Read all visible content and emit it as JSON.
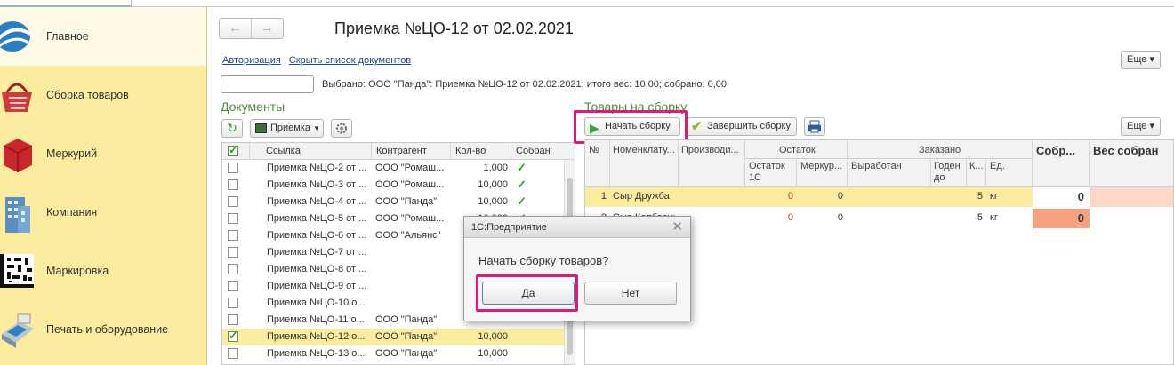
{
  "sidebar": {
    "items": [
      {
        "label": "Главное",
        "icon": "globe-logo-icon",
        "active": true
      },
      {
        "label": "Сборка товаров",
        "icon": "shopping-basket-icon"
      },
      {
        "label": "Меркурий",
        "icon": "red-cube-icon"
      },
      {
        "label": "Компания",
        "icon": "building-icon"
      },
      {
        "label": "Маркировка",
        "icon": "datamatrix-code-icon"
      },
      {
        "label": "Печать и оборудование",
        "icon": "printer-terminal-icon"
      }
    ]
  },
  "header": {
    "back": "←",
    "forward": "→",
    "title": "Приемка №ЦО-12 от 02.02.2021",
    "links": [
      "Авторизация",
      "Скрыть список документов"
    ],
    "more_label": "Еще ▾"
  },
  "filter": {
    "value": "",
    "selected_text": "Выбрано: ООО \"Панда\": Приемка №ЦО-12 от 02.02.2021; итого вес: 10,00; собрано: 0,00"
  },
  "documents": {
    "title": "Документы",
    "refresh_icon": "↻",
    "type_select": "Приемка",
    "columns": [
      "Ссылка",
      "Контрагент",
      "Кол-во",
      "Собран"
    ],
    "rows": [
      {
        "link": "Приемка №ЦО-2 от ...",
        "partner": "ООО \"Ромаш...",
        "qty": "1,000",
        "done": "✓",
        "selected": false
      },
      {
        "link": "Приемка №ЦО-3 от ...",
        "partner": "ООО \"Ромаш...",
        "qty": "10,000",
        "done": "✓",
        "selected": false
      },
      {
        "link": "Приемка №ЦО-4 от ...",
        "partner": "ООО \"Панда\"",
        "qty": "10,000",
        "done": "✓",
        "selected": false
      },
      {
        "link": "Приемка №ЦО-5 от ...",
        "partner": "ООО \"Ромаш...",
        "qty": "10,000",
        "done": "✓",
        "selected": false
      },
      {
        "link": "Приемка №ЦО-6 от ...",
        "partner": "ООО \"Альянс\"",
        "qty": "",
        "done": "",
        "selected": false
      },
      {
        "link": "Приемка №ЦО-7 от ...",
        "partner": "",
        "qty": "",
        "done": "",
        "selected": false
      },
      {
        "link": "Приемка №ЦО-8 от ...",
        "partner": "",
        "qty": "",
        "done": "",
        "selected": false
      },
      {
        "link": "Приемка №ЦО-9 от ...",
        "partner": "",
        "qty": "",
        "done": "",
        "selected": false
      },
      {
        "link": "Приемка №ЦО-10 о...",
        "partner": "",
        "qty": "",
        "done": "",
        "selected": false
      },
      {
        "link": "Приемка №ЦО-11 о...",
        "partner": "ООО \"Панда\"",
        "qty": "",
        "done": "",
        "selected": false
      },
      {
        "link": "Приемка №ЦО-12 о...",
        "partner": "ООО \"Панда\"",
        "qty": "10,000",
        "done": "",
        "selected": true
      },
      {
        "link": "Приемка №ЦО-13 о...",
        "partner": "ООО \"Панда\"",
        "qty": "10,000",
        "done": "",
        "selected": false
      }
    ]
  },
  "goods": {
    "title": "Товары на сборку",
    "start_label": "Начать сборку",
    "finish_label": "Завершить сборку",
    "more_label": "Еще ▾",
    "headers": {
      "num": "№",
      "nomenclature": "Номенклату...",
      "producer": "Производи...",
      "stock": "Остаток",
      "stock_1c": "Остаток 1С",
      "stock_mercury": "Меркур...",
      "ordered": "Заказано",
      "produced": "Выработан",
      "valid_until": "Годен до",
      "k": "К...",
      "unit": "Ед.",
      "collected": "Собр...",
      "weight_collected": "Вес собран"
    },
    "rows": [
      {
        "n": "1",
        "name": "Сыр Дружба",
        "stock_1c": "0",
        "mercury": "0",
        "k": "5",
        "unit": "кг",
        "collected": "0"
      },
      {
        "n": "2",
        "name": "Сыр Колбасный",
        "stock_1c": "0",
        "mercury": "0",
        "k": "5",
        "unit": "кг",
        "collected": "0"
      }
    ]
  },
  "dialog": {
    "title": "1С:Предприятие",
    "close": "✕",
    "message": "Начать сборку товаров?",
    "yes": "Да",
    "no": "Нет"
  },
  "colors": {
    "sidebar_bg": "#fbeca0",
    "highlight": "#e0197d",
    "section_title": "#4c8a3c",
    "collected_empty": "#f7a27e"
  }
}
